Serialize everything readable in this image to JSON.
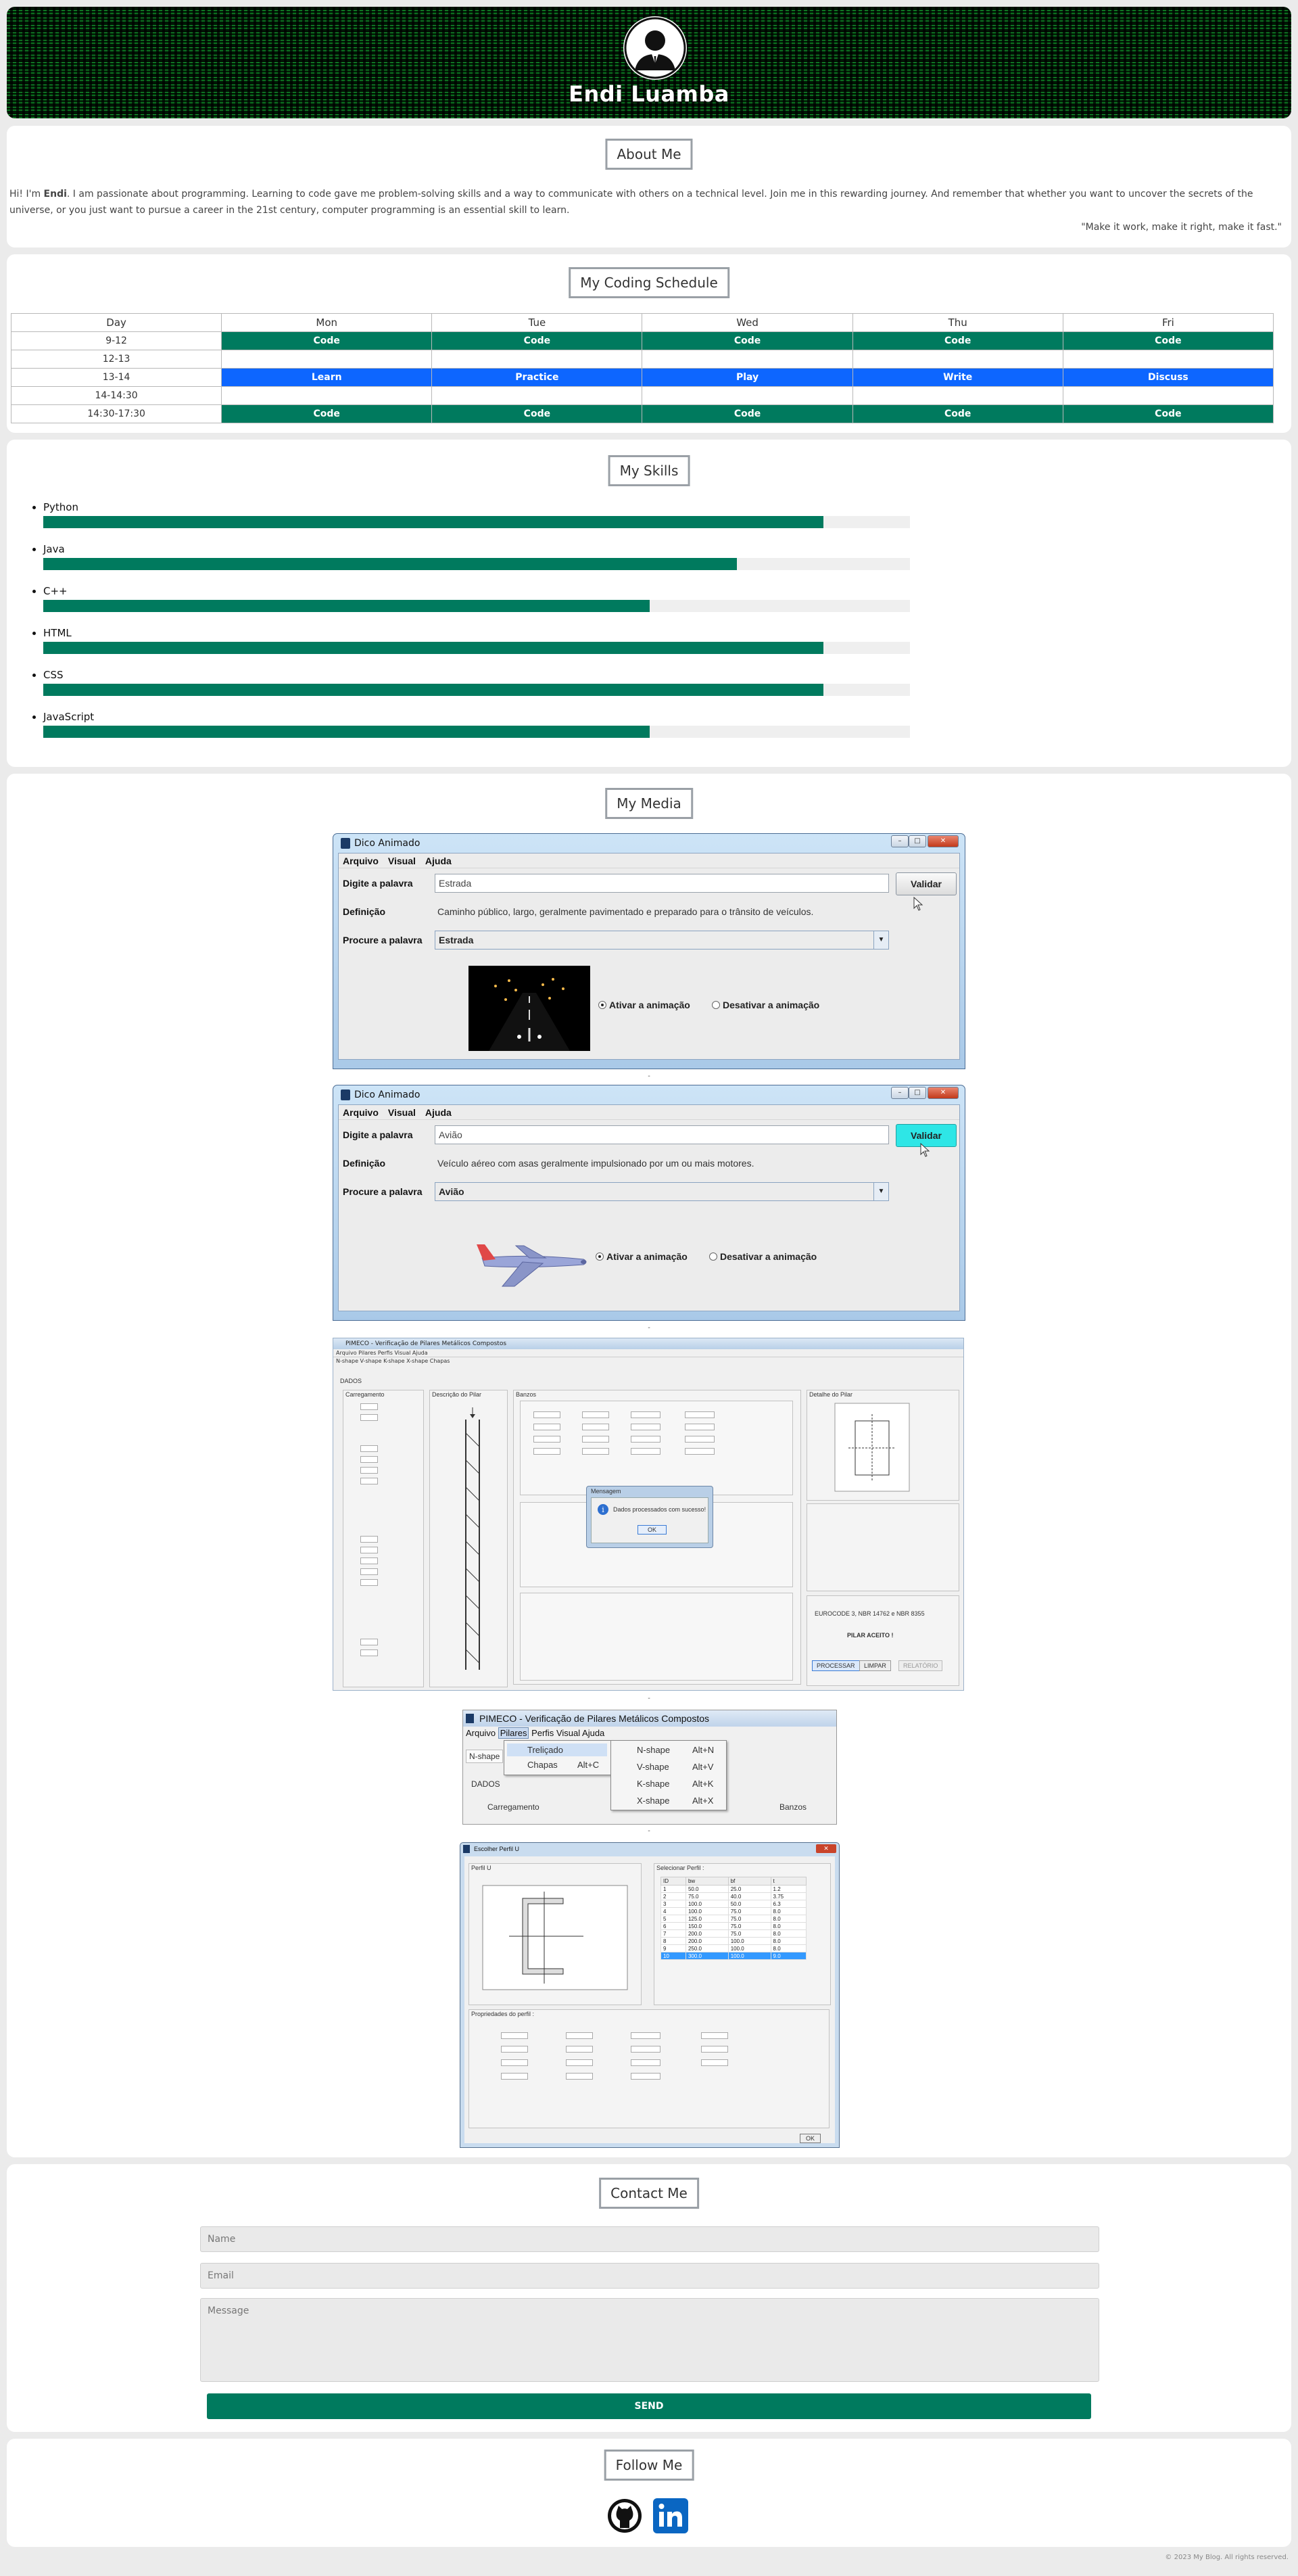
{
  "site": {
    "name": "Endi Luamba",
    "copyright": "© 2023 My Blog. All rights reserved."
  },
  "about": {
    "title": "About Me",
    "greeting": "Hi! I'm ",
    "name_bold": "Endi",
    "text": ". I am passionate about programming. Learning to code gave me problem-solving skills and a way to communicate with others on a technical level. Join me in this rewarding journey. And remember that whether you want to uncover the secrets of the universe, or you just want to pursue a career in the 21st century, computer programming is an essential skill to learn.",
    "quote": "\"Make it work, make it right, make it fast.\""
  },
  "schedule": {
    "title": "My Coding Schedule",
    "headers": [
      "Day",
      "Mon",
      "Tue",
      "Wed",
      "Thu",
      "Fri"
    ],
    "rows": [
      {
        "time": "9-12",
        "style": "code",
        "cells": [
          "Code",
          "Code",
          "Code",
          "Code",
          "Code"
        ]
      },
      {
        "time": "12-13",
        "style": "empty",
        "cells": [
          "",
          "",
          "",
          "",
          ""
        ]
      },
      {
        "time": "13-14",
        "style": "blue",
        "cells": [
          "Learn",
          "Practice",
          "Play",
          "Write",
          "Discuss"
        ]
      },
      {
        "time": "14-14:30",
        "style": "empty",
        "cells": [
          "",
          "",
          "",
          "",
          ""
        ]
      },
      {
        "time": "14:30-17:30",
        "style": "code",
        "cells": [
          "Code",
          "Code",
          "Code",
          "Code",
          "Code"
        ]
      }
    ]
  },
  "skills": {
    "title": "My Skills",
    "items": [
      {
        "name": "Python",
        "level": 0.9
      },
      {
        "name": "Java",
        "level": 0.8
      },
      {
        "name": "C++",
        "level": 0.7
      },
      {
        "name": "HTML",
        "level": 0.9
      },
      {
        "name": "CSS",
        "level": 0.9
      },
      {
        "name": "JavaScript",
        "level": 0.7
      }
    ]
  },
  "media": {
    "title": "My Media",
    "caption": "-",
    "dico1": {
      "title": "Dico Animado",
      "menu": [
        "Arquivo",
        "Visual",
        "Ajuda"
      ],
      "word_label": "Digite a palavra",
      "word_value": "Estrada",
      "validate": "Validar",
      "def_label": "Definição",
      "def_value": "Caminho público, largo, geralmente pavimentado e preparado para o trânsito de veículos.",
      "search_label": "Procure a palavra",
      "search_value": "Estrada",
      "radio_on": "Ativar a animação",
      "radio_off": "Desativar a animação"
    },
    "dico2": {
      "title": "Dico Animado",
      "menu": [
        "Arquivo",
        "Visual",
        "Ajuda"
      ],
      "word_label": "Digite a palavra",
      "word_value": "Avião",
      "validate": "Validar",
      "def_label": "Definição",
      "def_value": "Veículo aéreo com asas geralmente impulsionado por um ou mais motores.",
      "search_label": "Procure a palavra",
      "search_value": "Avião",
      "radio_on": "Ativar a animação",
      "radio_off": "Desativar a animação"
    },
    "pimeco": {
      "title": "PIMECO - Verificação de Pilares Metálicos Compostos",
      "menu": [
        "Arquivo",
        "Pilares",
        "Perfis",
        "Visual",
        "Ajuda"
      ],
      "tabs": "N-shape  V-shape  K-shape  X-shape  Chapas",
      "dados": "DADOS",
      "carregamento": "Carregamento",
      "descricao": "Descrição do Pilar",
      "banzos": "Banzos",
      "detalhe": "Detalhe do Pilar",
      "dialog_title": "Mensagem",
      "dialog_msg": "Dados processados com sucesso!",
      "dialog_ok": "OK",
      "norms": "EUROCODE 3, NBR 14762 e NBR 8355",
      "result": "PILAR ACEITO !",
      "btn_process": "PROCESSAR",
      "btn_clear": "LIMPAR",
      "btn_report": "RELATÓRIO"
    },
    "pimeco_menu": {
      "title": "PIMECO - Verificação de Pilares Metálicos Compostos",
      "menu": [
        "Arquivo",
        "Pilares",
        "Perfis",
        "Visual",
        "Ajuda"
      ],
      "tab": "N-shape",
      "dados": "DADOS",
      "carregamento": "Carregamento",
      "banzos": "Banzos",
      "submenu": [
        {
          "label": "Treliçado",
          "shortcut": ""
        },
        {
          "label": "Chapas",
          "shortcut": "Alt+C"
        }
      ],
      "flyout": [
        {
          "label": "N-shape",
          "shortcut": "Alt+N"
        },
        {
          "label": "V-shape",
          "shortcut": "Alt+V"
        },
        {
          "label": "K-shape",
          "shortcut": "Alt+K"
        },
        {
          "label": "X-shape",
          "shortcut": "Alt+X"
        }
      ]
    },
    "perfil": {
      "title": "Escolher Perfil U",
      "group_left": "Perfil U",
      "group_right": "Selecionar Perfil :",
      "columns": [
        "ID",
        "bw",
        "bf",
        "t"
      ],
      "rows": [
        [
          "1",
          "50.0",
          "25.0",
          "1.2"
        ],
        [
          "2",
          "75.0",
          "40.0",
          "3.75"
        ],
        [
          "3",
          "100.0",
          "50.0",
          "6.3"
        ],
        [
          "4",
          "100.0",
          "75.0",
          "8.0"
        ],
        [
          "5",
          "125.0",
          "75.0",
          "8.0"
        ],
        [
          "6",
          "150.0",
          "75.0",
          "8.0"
        ],
        [
          "7",
          "200.0",
          "75.0",
          "8.0"
        ],
        [
          "8",
          "200.0",
          "100.0",
          "8.0"
        ],
        [
          "9",
          "250.0",
          "100.0",
          "8.0"
        ],
        [
          "10",
          "300.0",
          "100.0",
          "9.0"
        ]
      ],
      "props_title": "Propriedades do perfil :",
      "ok": "OK"
    }
  },
  "contact": {
    "title": "Contact Me",
    "name_placeholder": "Name",
    "email_placeholder": "Email",
    "message_placeholder": "Message",
    "send": "SEND"
  },
  "follow": {
    "title": "Follow Me",
    "links": [
      "github-icon",
      "linkedin-icon"
    ]
  },
  "colors": {
    "accent": "#007a5e",
    "blue": "#0d66ff"
  }
}
